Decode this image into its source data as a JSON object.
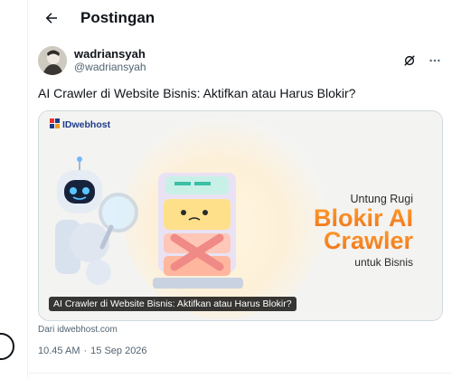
{
  "header": {
    "title": "Postingan",
    "back_icon": "arrow-left-icon"
  },
  "post": {
    "author": {
      "display_name": "wadriansyah",
      "handle": "@wadriansyah"
    },
    "actions": {
      "grok_icon": "grok-slash-icon",
      "more_icon": "more-horizontal-icon"
    },
    "text": "AI Crawler di Website Bisnis: Aktifkan atau Harus Blokir?",
    "card": {
      "brand": "IDwebhost",
      "headline_top": "Untung Rugi",
      "headline_line1": "Blokir AI",
      "headline_line2": "Crawler",
      "headline_bottom": "untuk Bisnis",
      "caption": "AI Crawler di Website Bisnis: Aktifkan atau Harus Blokir?",
      "source": "Dari idwebhost.com",
      "colors": {
        "accent_orange": "#f39a1b",
        "brand_blue": "#1d3a8a"
      }
    },
    "time": "10.45 AM",
    "separator": "·",
    "date": "15 Sep 2026"
  }
}
